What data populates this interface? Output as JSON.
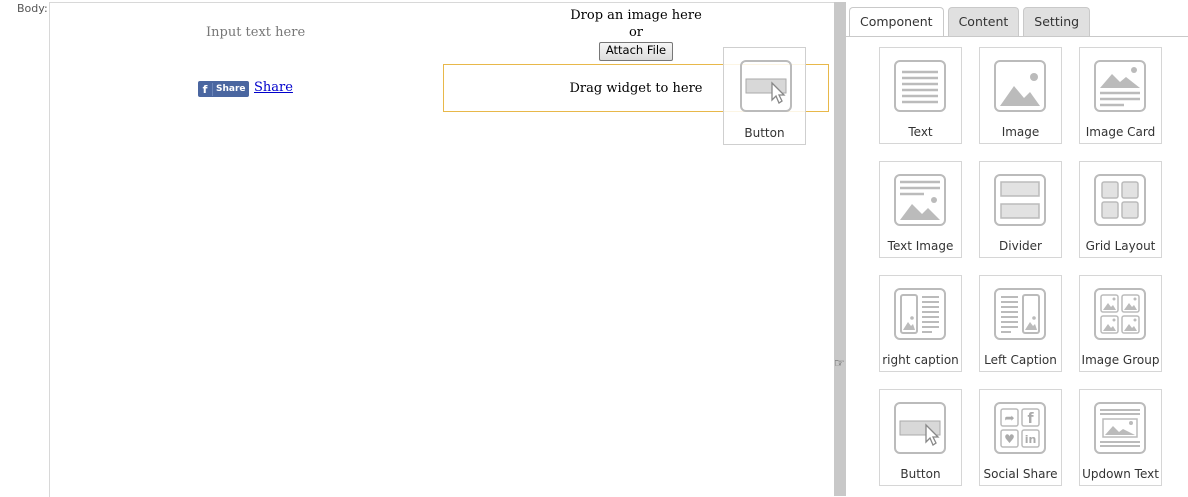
{
  "body_label": "Body:",
  "canvas": {
    "input_placeholder": "Input text here",
    "image_drop": {
      "line1": "Drop an image here",
      "line2": "or",
      "attach_label": "Attach File"
    },
    "fb_share_badge": "Share",
    "share_link": "Share",
    "drop_zone_text": "Drag widget to here",
    "drag_ghost_label": "Button"
  },
  "panel": {
    "tabs": [
      {
        "label": "Component",
        "active": true
      },
      {
        "label": "Content",
        "active": false
      },
      {
        "label": "Setting",
        "active": false
      }
    ],
    "components": [
      {
        "label": "Text",
        "icon": "text-icon"
      },
      {
        "label": "Image",
        "icon": "image-icon"
      },
      {
        "label": "Image Card",
        "icon": "image-card-icon"
      },
      {
        "label": "Text Image",
        "icon": "text-image-icon"
      },
      {
        "label": "Divider",
        "icon": "divider-icon"
      },
      {
        "label": "Grid Layout",
        "icon": "grid-layout-icon"
      },
      {
        "label": "right caption",
        "icon": "right-caption-icon"
      },
      {
        "label": "Left Caption",
        "icon": "left-caption-icon"
      },
      {
        "label": "Image Group",
        "icon": "image-group-icon"
      },
      {
        "label": "Button",
        "icon": "button-icon"
      },
      {
        "label": "Social Share",
        "icon": "social-share-icon"
      },
      {
        "label": "Updown Text",
        "icon": "updown-text-icon"
      }
    ]
  }
}
